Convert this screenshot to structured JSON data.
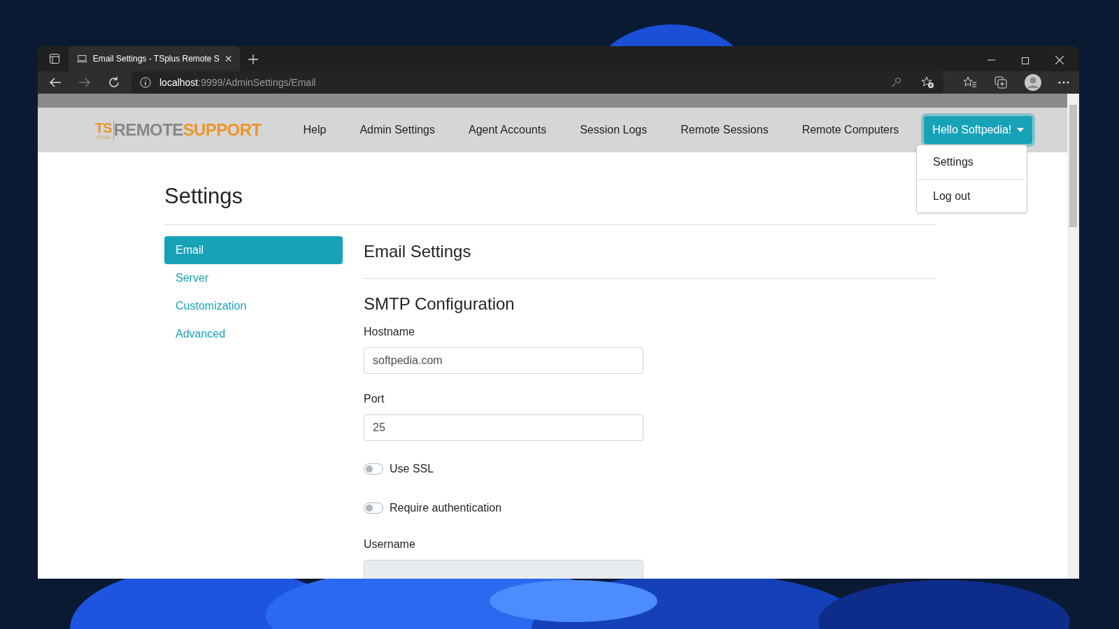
{
  "browser": {
    "tab_title": "Email Settings - TSplus Remote S",
    "url_host": "localhost",
    "url_path": ":9999/AdminSettings/Email"
  },
  "navbar": {
    "logo": {
      "prefix": "TS",
      "prefix_small": "PLUS",
      "name_a": "REMOTE",
      "name_b": "SUPPORT"
    },
    "items": [
      {
        "label": "Help"
      },
      {
        "label": "Admin Settings"
      },
      {
        "label": "Agent Accounts"
      },
      {
        "label": "Session Logs"
      },
      {
        "label": "Remote Sessions"
      },
      {
        "label": "Remote Computers"
      }
    ],
    "user_button": "Hello Softpedia!",
    "user_menu": {
      "expanded": true,
      "items": [
        "Settings",
        "Log out"
      ]
    }
  },
  "page_title": "Settings",
  "sidebar": {
    "items": [
      {
        "label": "Email",
        "selected": true
      },
      {
        "label": "Server",
        "selected": false
      },
      {
        "label": "Customization",
        "selected": false
      },
      {
        "label": "Advanced",
        "selected": false
      }
    ]
  },
  "section_title": "Email Settings",
  "subsection_title": "SMTP Configuration",
  "fields": [
    {
      "kind": "text",
      "label": "Hostname",
      "value": "softpedia.com",
      "disabled": false
    },
    {
      "kind": "text",
      "label": "Port",
      "value": "25",
      "disabled": false
    },
    {
      "kind": "toggle",
      "label": "Use SSL",
      "on": false
    },
    {
      "kind": "toggle",
      "label": "Require authentication",
      "on": false
    },
    {
      "kind": "text",
      "label": "Username",
      "disabled": true
    }
  ]
}
